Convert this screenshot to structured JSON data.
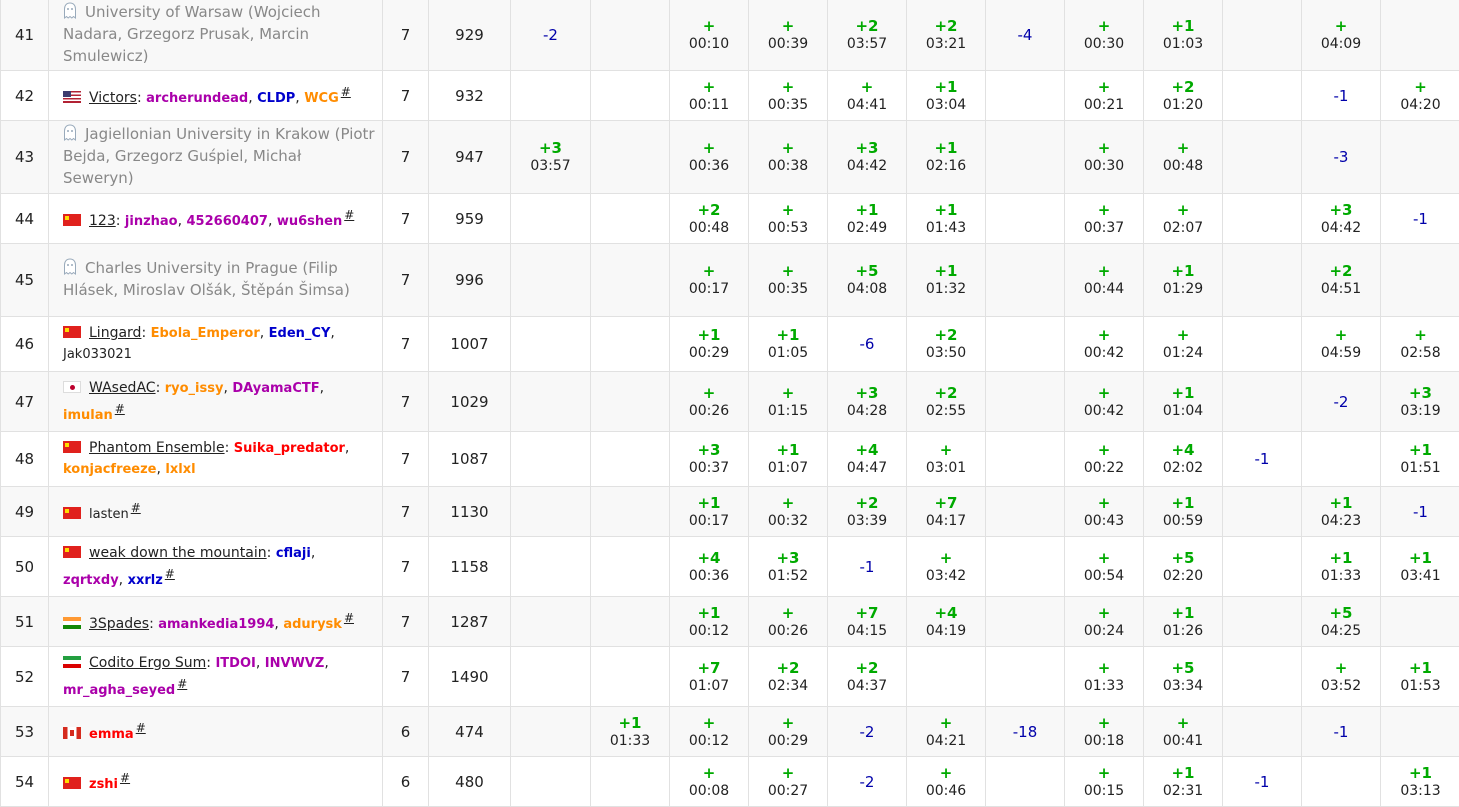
{
  "colors": {
    "accepted": "#00aa00",
    "rejected": "#0000aa",
    "grid": "#e1e1e1",
    "stripe": "#f8f8f8"
  },
  "rows": [
    {
      "rank": "41",
      "kind": "ghost",
      "ghost": "University of Warsaw (Wojciech Nadara, Grzegorz Prusak, Marcin Smulewicz)",
      "solved": "7",
      "penalty": "929",
      "cells": [
        {
          "r": "-2"
        },
        {},
        {
          "p": "+",
          "t": "00:10"
        },
        {
          "p": "+",
          "t": "00:39"
        },
        {
          "p": "+2",
          "t": "03:57"
        },
        {
          "p": "+2",
          "t": "03:21"
        },
        {
          "r": "-4"
        },
        {
          "p": "+",
          "t": "00:30"
        },
        {
          "p": "+1",
          "t": "01:03"
        },
        {},
        {
          "p": "+",
          "t": "04:09"
        },
        {}
      ]
    },
    {
      "rank": "42",
      "kind": "team",
      "flag": "us",
      "team": "Victors",
      "members": [
        {
          "n": "archerundead",
          "c": "violet"
        },
        {
          "n": "CLDP",
          "c": "blue"
        },
        {
          "n": "WCG",
          "c": "orange"
        }
      ],
      "hash": "#",
      "solved": "7",
      "penalty": "932",
      "cells": [
        {},
        {},
        {
          "p": "+",
          "t": "00:11"
        },
        {
          "p": "+",
          "t": "00:35"
        },
        {
          "p": "+",
          "t": "04:41"
        },
        {
          "p": "+1",
          "t": "03:04"
        },
        {},
        {
          "p": "+",
          "t": "00:21"
        },
        {
          "p": "+2",
          "t": "01:20"
        },
        {},
        {
          "r": "-1"
        },
        {
          "p": "+",
          "t": "04:20"
        }
      ]
    },
    {
      "rank": "43",
      "kind": "ghost",
      "ghost": "Jagiellonian University in Krakow (Piotr Bejda, Grzegorz Guśpiel, Michał Seweryn)",
      "solved": "7",
      "penalty": "947",
      "cells": [
        {
          "p": "+3",
          "t": "03:57"
        },
        {},
        {
          "p": "+",
          "t": "00:36"
        },
        {
          "p": "+",
          "t": "00:38"
        },
        {
          "p": "+3",
          "t": "04:42"
        },
        {
          "p": "+1",
          "t": "02:16"
        },
        {},
        {
          "p": "+",
          "t": "00:30"
        },
        {
          "p": "+",
          "t": "00:48"
        },
        {},
        {
          "r": "-3"
        },
        {}
      ]
    },
    {
      "rank": "44",
      "kind": "team",
      "flag": "cn",
      "team": "123",
      "members": [
        {
          "n": "jinzhao",
          "c": "violet"
        },
        {
          "n": "452660407",
          "c": "violet"
        },
        {
          "n": "wu6shen",
          "c": "violet"
        }
      ],
      "hash": "#",
      "solved": "7",
      "penalty": "959",
      "cells": [
        {},
        {},
        {
          "p": "+2",
          "t": "00:48"
        },
        {
          "p": "+",
          "t": "00:53"
        },
        {
          "p": "+1",
          "t": "02:49"
        },
        {
          "p": "+1",
          "t": "01:43"
        },
        {},
        {
          "p": "+",
          "t": "00:37"
        },
        {
          "p": "+",
          "t": "02:07"
        },
        {},
        {
          "p": "+3",
          "t": "04:42"
        },
        {
          "r": "-1"
        }
      ]
    },
    {
      "rank": "45",
      "kind": "ghost",
      "ghost": "Charles University in Prague (Filip Hlásek, Miroslav Olšák, Štěpán Šimsa)",
      "solved": "7",
      "penalty": "996",
      "cells": [
        {},
        {},
        {
          "p": "+",
          "t": "00:17"
        },
        {
          "p": "+",
          "t": "00:35"
        },
        {
          "p": "+5",
          "t": "04:08"
        },
        {
          "p": "+1",
          "t": "01:32"
        },
        {},
        {
          "p": "+",
          "t": "00:44"
        },
        {
          "p": "+1",
          "t": "01:29"
        },
        {},
        {
          "p": "+2",
          "t": "04:51"
        },
        {}
      ]
    },
    {
      "rank": "46",
      "kind": "team",
      "flag": "cn",
      "team": "Lingard",
      "members": [
        {
          "n": "Ebola_Emperor",
          "c": "orange"
        },
        {
          "n": "Eden_CY",
          "c": "blue"
        },
        {
          "n": "Jak033021",
          "c": "black"
        }
      ],
      "hash": "",
      "solved": "7",
      "penalty": "1007",
      "cells": [
        {},
        {},
        {
          "p": "+1",
          "t": "00:29"
        },
        {
          "p": "+1",
          "t": "01:05"
        },
        {
          "r": "-6"
        },
        {
          "p": "+2",
          "t": "03:50"
        },
        {},
        {
          "p": "+",
          "t": "00:42"
        },
        {
          "p": "+",
          "t": "01:24"
        },
        {},
        {
          "p": "+",
          "t": "04:59"
        },
        {
          "p": "+",
          "t": "02:58"
        }
      ]
    },
    {
      "rank": "47",
      "kind": "team",
      "flag": "jp",
      "team": "WAsedAC",
      "members": [
        {
          "n": "ryo_issy",
          "c": "orange"
        },
        {
          "n": "DAyamaCTF",
          "c": "violet"
        },
        {
          "n": "imulan",
          "c": "orange"
        }
      ],
      "hash": "#",
      "solved": "7",
      "penalty": "1029",
      "cells": [
        {},
        {},
        {
          "p": "+",
          "t": "00:26"
        },
        {
          "p": "+",
          "t": "01:15"
        },
        {
          "p": "+3",
          "t": "04:28"
        },
        {
          "p": "+2",
          "t": "02:55"
        },
        {},
        {
          "p": "+",
          "t": "00:42"
        },
        {
          "p": "+1",
          "t": "01:04"
        },
        {},
        {
          "r": "-2"
        },
        {
          "p": "+3",
          "t": "03:19"
        }
      ]
    },
    {
      "rank": "48",
      "kind": "team",
      "flag": "cn",
      "team": "Phantom Ensemble",
      "members": [
        {
          "n": "Suika_predator",
          "c": "red"
        },
        {
          "n": "konjacfreeze",
          "c": "orange"
        },
        {
          "n": "lxlxl",
          "c": "orange"
        }
      ],
      "hash": "",
      "solved": "7",
      "penalty": "1087",
      "cells": [
        {},
        {},
        {
          "p": "+3",
          "t": "00:37"
        },
        {
          "p": "+1",
          "t": "01:07"
        },
        {
          "p": "+4",
          "t": "04:47"
        },
        {
          "p": "+",
          "t": "03:01"
        },
        {},
        {
          "p": "+",
          "t": "00:22"
        },
        {
          "p": "+4",
          "t": "02:02"
        },
        {
          "r": "-1"
        },
        {},
        {
          "p": "+1",
          "t": "01:51"
        }
      ]
    },
    {
      "rank": "49",
      "kind": "solo",
      "flag": "cn",
      "solo": "lasten",
      "soloColor": "black",
      "hash": "#",
      "solved": "7",
      "penalty": "1130",
      "cells": [
        {},
        {},
        {
          "p": "+1",
          "t": "00:17"
        },
        {
          "p": "+",
          "t": "00:32"
        },
        {
          "p": "+2",
          "t": "03:39"
        },
        {
          "p": "+7",
          "t": "04:17"
        },
        {},
        {
          "p": "+",
          "t": "00:43"
        },
        {
          "p": "+1",
          "t": "00:59"
        },
        {},
        {
          "p": "+1",
          "t": "04:23"
        },
        {
          "r": "-1"
        }
      ]
    },
    {
      "rank": "50",
      "kind": "team",
      "flag": "cn",
      "team": "weak down the mountain",
      "members": [
        {
          "n": "cflaji",
          "c": "blue"
        },
        {
          "n": "zqrtxdy",
          "c": "violet"
        },
        {
          "n": "xxrlz",
          "c": "blue"
        }
      ],
      "hash": "#",
      "solved": "7",
      "penalty": "1158",
      "cells": [
        {},
        {},
        {
          "p": "+4",
          "t": "00:36"
        },
        {
          "p": "+3",
          "t": "01:52"
        },
        {
          "r": "-1"
        },
        {
          "p": "+",
          "t": "03:42"
        },
        {},
        {
          "p": "+",
          "t": "00:54"
        },
        {
          "p": "+5",
          "t": "02:20"
        },
        {},
        {
          "p": "+1",
          "t": "01:33"
        },
        {
          "p": "+1",
          "t": "03:41"
        }
      ]
    },
    {
      "rank": "51",
      "kind": "team",
      "flag": "in",
      "team": "3Spades",
      "members": [
        {
          "n": "amankedia1994",
          "c": "violet"
        },
        {
          "n": "adurysk",
          "c": "orange"
        }
      ],
      "hash": "#",
      "solved": "7",
      "penalty": "1287",
      "cells": [
        {},
        {},
        {
          "p": "+1",
          "t": "00:12"
        },
        {
          "p": "+",
          "t": "00:26"
        },
        {
          "p": "+7",
          "t": "04:15"
        },
        {
          "p": "+4",
          "t": "04:19"
        },
        {},
        {
          "p": "+",
          "t": "00:24"
        },
        {
          "p": "+1",
          "t": "01:26"
        },
        {},
        {
          "p": "+5",
          "t": "04:25"
        },
        {}
      ]
    },
    {
      "rank": "52",
      "kind": "team",
      "flag": "ir",
      "team": "Codito Ergo Sum",
      "members": [
        {
          "n": "ITDOI",
          "c": "violet"
        },
        {
          "n": "INVWVZ",
          "c": "violet"
        },
        {
          "n": "mr_agha_seyed",
          "c": "violet"
        }
      ],
      "hash": "#",
      "solved": "7",
      "penalty": "1490",
      "cells": [
        {},
        {},
        {
          "p": "+7",
          "t": "01:07"
        },
        {
          "p": "+2",
          "t": "02:34"
        },
        {
          "p": "+2",
          "t": "04:37"
        },
        {},
        {},
        {
          "p": "+",
          "t": "01:33"
        },
        {
          "p": "+5",
          "t": "03:34"
        },
        {},
        {
          "p": "+",
          "t": "03:52"
        },
        {
          "p": "+1",
          "t": "01:53"
        }
      ]
    },
    {
      "rank": "53",
      "kind": "solo",
      "flag": "ca",
      "solo": "emma",
      "soloColor": "red",
      "hash": "#",
      "solved": "6",
      "penalty": "474",
      "cells": [
        {},
        {
          "p": "+1",
          "t": "01:33"
        },
        {
          "p": "+",
          "t": "00:12"
        },
        {
          "p": "+",
          "t": "00:29"
        },
        {
          "r": "-2"
        },
        {
          "p": "+",
          "t": "04:21"
        },
        {
          "r": "-18"
        },
        {
          "p": "+",
          "t": "00:18"
        },
        {
          "p": "+",
          "t": "00:41"
        },
        {},
        {
          "r": "-1"
        },
        {}
      ]
    },
    {
      "rank": "54",
      "kind": "solo",
      "flag": "cn",
      "solo": "zshi",
      "soloColor": "red",
      "hash": "#",
      "solved": "6",
      "penalty": "480",
      "cells": [
        {},
        {},
        {
          "p": "+",
          "t": "00:08"
        },
        {
          "p": "+",
          "t": "00:27"
        },
        {
          "r": "-2"
        },
        {
          "p": "+",
          "t": "00:46"
        },
        {},
        {
          "p": "+",
          "t": "00:15"
        },
        {
          "p": "+1",
          "t": "02:31"
        },
        {
          "r": "-1"
        },
        {},
        {
          "p": "+1",
          "t": "03:13"
        }
      ]
    }
  ]
}
